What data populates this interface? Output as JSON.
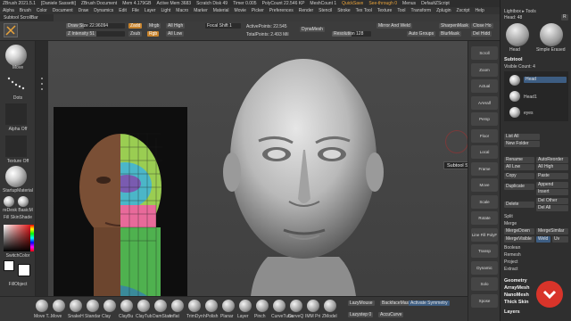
{
  "titlebar": {
    "app": "ZBrush 2021.5.1",
    "user": "[Daniele Sassetti]",
    "doc": "ZBrush Document",
    "mem": "Mem 4.179GB",
    "active_mem": "Active Mem 3683",
    "scratch": "Scratch Disk 49",
    "timer": "Timer 0.005",
    "polycount": "PolyCount 22.546 KP",
    "meshcount": "MeshCount 1",
    "quicksave": "QuickSave",
    "see_through": "See-through 0",
    "menus": "Menus",
    "default_script": "DefaultZScript"
  },
  "menubar": [
    "Alpha",
    "Brush",
    "Color",
    "Document",
    "Draw",
    "Dynamics",
    "Edit",
    "File",
    "Layer",
    "Light",
    "Macro",
    "Marker",
    "Material",
    "Movie",
    "Picker",
    "Preferences",
    "Render",
    "Stencil",
    "Stroke",
    "Tex Tool",
    "Texture",
    "Tool",
    "Transform",
    "Zplugin",
    "Zscript",
    "Help"
  ],
  "subtool_scrollbar_label": "Subtool ScrollBar",
  "toolbar": {
    "draw_size_label": "Draw Size",
    "draw_size_value": "22.96094",
    "z_intensity_label": "Z Intensity",
    "z_intensity_value": "51",
    "zadd": "Zadd",
    "zsub": "Zsub",
    "rgb": "Rgb",
    "all_high": "All High",
    "all_low": "All Low",
    "dynamic": "Dynamic",
    "mrgb": "Mrgb",
    "focal": "Focal Shift 1",
    "active_points": "ActivePoints: 22.545",
    "total_points": "TotalPoints: 2.493 Mil",
    "dynamesh": "DynaMesh",
    "resolution": "Resolution 128",
    "mirror_weld": "Mirror And Weld",
    "auto_groups": "Auto Groups",
    "sharpen_mask": "SharpenMask",
    "blur_mask": "BlurMask",
    "close_holes": "Close Ho",
    "del_hidden": "Del Hidd"
  },
  "lefttray": {
    "move": "Move",
    "dots": "Dots",
    "alpha_off": "Alpha Off",
    "texture_off": "Texture Off",
    "startup_material": "StartupMaterial",
    "redesk_basicm": "reDesk BasicM",
    "fill_skinshade": "Fill SkinShade",
    "switch_color": "SwitchColor",
    "fill_object": "FillObject"
  },
  "rightpanel": {
    "head_label": "Head: 48",
    "lightbox": "Lightbox ▸ Tools",
    "r_badge": "R",
    "thumb1": "Head",
    "thumb2": "Simple Erased",
    "subtool_title": "Subtool",
    "visible_count": "Visible Count: 4",
    "sub_items": [
      "Head",
      "Head1",
      "eyes"
    ],
    "list_all": "List All",
    "new_folder": "New Folder",
    "rename": "Rename",
    "auto_reorder": "AutoReorder",
    "all_low": "All Low",
    "all_high": "All High",
    "copy": "Copy",
    "paste": "Paste",
    "duplicate": "Duplicate",
    "append": "Append",
    "insert": "Insert",
    "delete": "Delete",
    "del_other": "Del Other",
    "del_all": "Del All",
    "split": "Split",
    "merge": "Merge",
    "merge_down": "MergeDown",
    "merge_similar": "MergeSimilar",
    "merge_visible": "MergeVisible",
    "weld": "Weld",
    "uv": "Uv",
    "boolean": "Boolean",
    "remesh": "Remesh",
    "project": "Project",
    "extract": "Extract",
    "geometry": "Geometry",
    "arraymesh": "ArrayMesh",
    "nanomesh": "NanoMesh",
    "thick_skin": "Thick Skin",
    "layers": "Layers"
  },
  "shelf": [
    "Scroll",
    "Zoom",
    "Actual",
    "AAHalf",
    "Persp",
    "Floor",
    "Local",
    "Frame",
    "Move",
    "Scale",
    "Rotate",
    "Line Fill PolyF",
    "Transp",
    "Dynamic",
    "Solo",
    "Xpose"
  ],
  "tooltip": "Subtool ScrollBar",
  "bottombar": {
    "brushes": [
      "Move T...",
      "Move",
      "SnakeH",
      "Standar",
      "Clay",
      "ClayBu",
      "ClayTub",
      "DamStan",
      "Inflat",
      "TrimDyn",
      "hPolish",
      "Planar",
      "Layer",
      "Pinch",
      "CurveTube",
      "CurveQ",
      "IMM Pri",
      "ZModel"
    ],
    "lazymouse": "LazyMouse",
    "backface": "BackfaceMask",
    "accucurve": "AccuCurve",
    "activate_symmetry": "Activate Symmetry",
    "lazy_step": "Lazystep 0"
  },
  "colors": {
    "accent_orange": "#c7822b",
    "active_blue": "#3d5d82",
    "canvas_bg": "#474747"
  }
}
